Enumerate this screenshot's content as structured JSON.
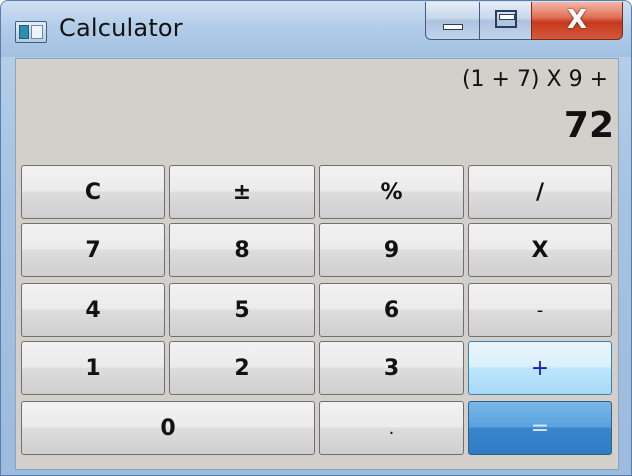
{
  "window": {
    "title": "Calculator",
    "close_glyph": "X"
  },
  "display": {
    "expression": "(1 + 7) X 9 +",
    "result": "72"
  },
  "keys": {
    "clear": "C",
    "plus_minus": "±",
    "percent": "%",
    "divide": "/",
    "seven": "7",
    "eight": "8",
    "nine": "9",
    "multiply": "X",
    "four": "4",
    "five": "5",
    "six": "6",
    "subtract": "-",
    "one": "1",
    "two": "2",
    "three": "3",
    "add": "+",
    "zero": "0",
    "decimal": ".",
    "equals": "="
  },
  "colors": {
    "titlebar": "#b3cde9",
    "client_background": "#d3cfca",
    "focused_key_text": "#1a1acc",
    "equals_key": "#3a86cc",
    "close_button": "#c7391c"
  }
}
